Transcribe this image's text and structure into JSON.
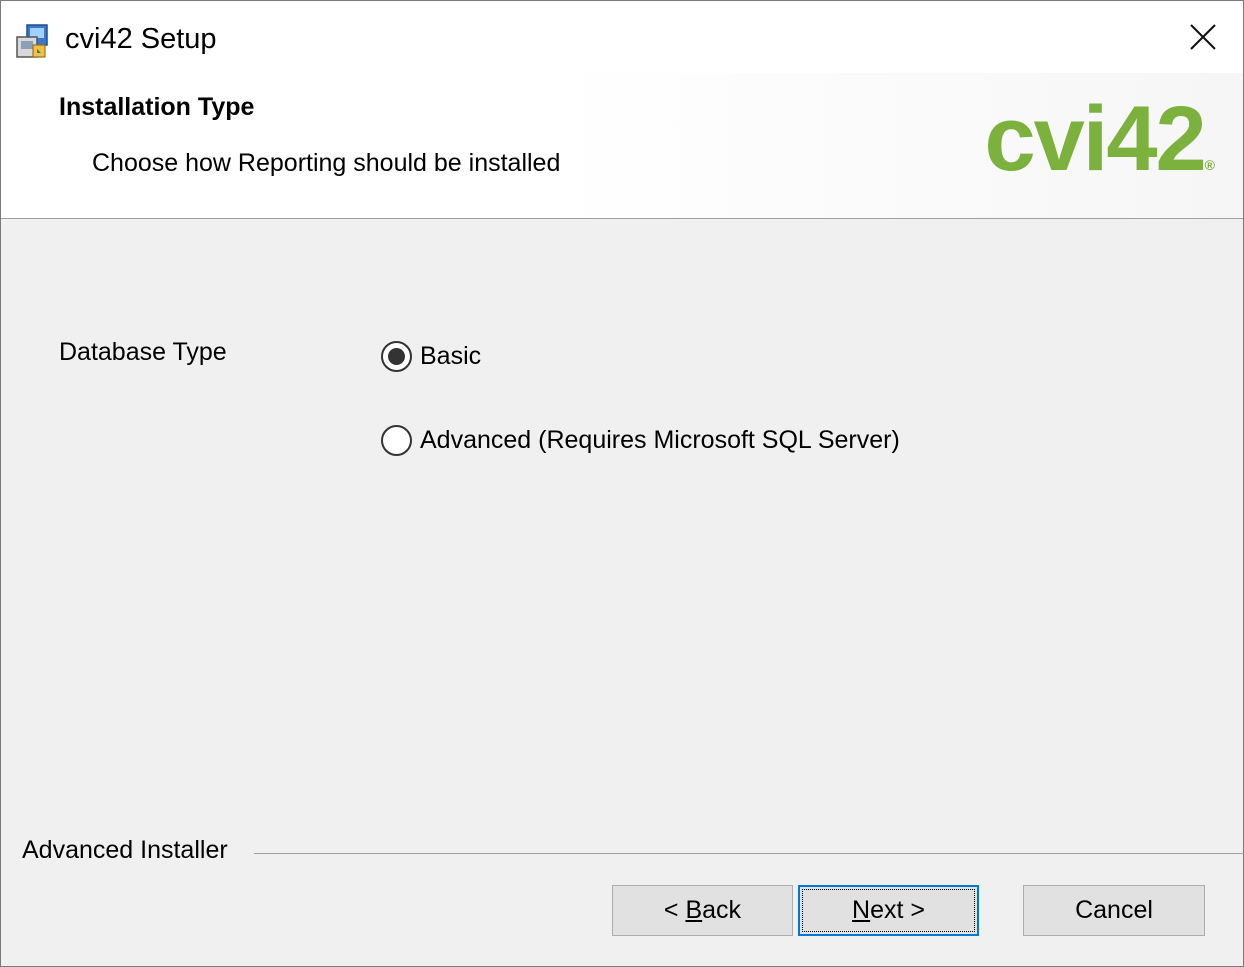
{
  "window": {
    "title": "cvi42 Setup",
    "icon": "installer-icon",
    "close_icon": "close-icon"
  },
  "header": {
    "title": "Installation Type",
    "subtitle": "Choose how Reporting should be installed",
    "logo_text": "cvi42",
    "logo_mark": "®",
    "logo_color": "#7bb13c"
  },
  "form": {
    "database_type_label": "Database Type",
    "options": [
      {
        "label": "Basic",
        "selected": true
      },
      {
        "label": "Advanced (Requires Microsoft SQL Server)",
        "selected": false
      }
    ]
  },
  "footer": {
    "brand": "Advanced Installer",
    "back_prefix": "< ",
    "back_accel": "B",
    "back_rest": "ack",
    "next_accel": "N",
    "next_rest": "ext >",
    "cancel_label": "Cancel"
  }
}
